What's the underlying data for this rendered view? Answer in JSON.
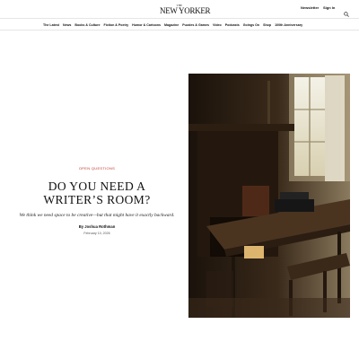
{
  "header": {
    "logo_small": "THE",
    "logo_main": "NEW YORKER",
    "newsletter_label": "Newsletter",
    "signin_label": "Sign In",
    "search_icon": "search-icon"
  },
  "nav": {
    "items": [
      {
        "label": "The Latest"
      },
      {
        "label": "News"
      },
      {
        "label": "Books & Culture"
      },
      {
        "label": "Fiction & Poetry"
      },
      {
        "label": "Humor & Cartoons"
      },
      {
        "label": "Magazine"
      },
      {
        "label": "Puzzles & Games"
      },
      {
        "label": "Video"
      },
      {
        "label": "Podcasts"
      },
      {
        "label": "Goings On"
      },
      {
        "label": "Shop"
      },
      {
        "label": "100th Anniversary"
      }
    ]
  },
  "article": {
    "rubric": "Open Questions",
    "headline": "Do You Need a Writer’s Room?",
    "dek": "We think we need space to be creative—but that might have it exactly backward.",
    "byline_prefix": "By",
    "byline_name": "Joshua Rothman",
    "date": "February 10, 2026"
  },
  "colors": {
    "rubric": "#c0392b",
    "text": "#111111",
    "rule": "#e6e6e6"
  }
}
